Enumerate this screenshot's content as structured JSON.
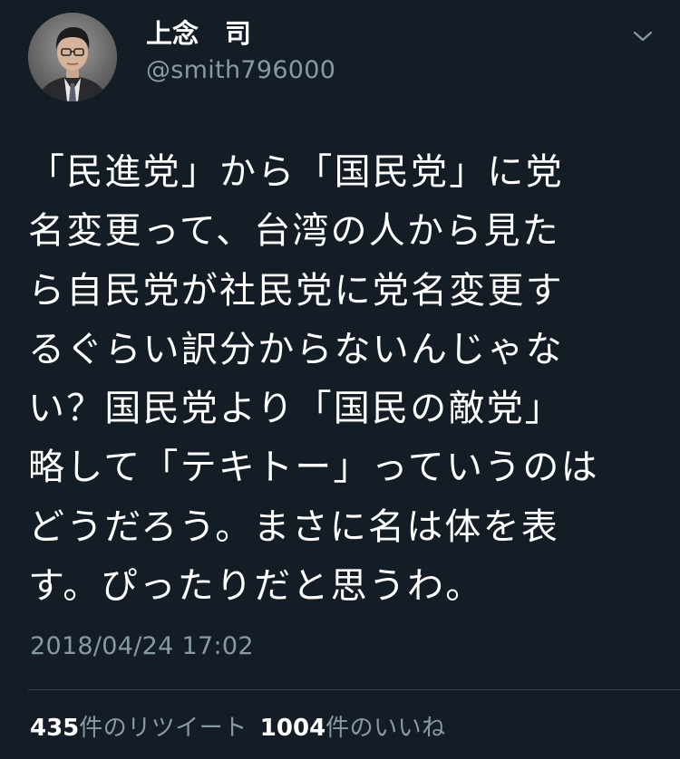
{
  "author": {
    "display_name": "上念　司",
    "handle": "@smith796000"
  },
  "tweet": {
    "lines": [
      "「民進党」から「国民党」に党",
      "名変更って、台湾の人から見た",
      "ら自民党が社民党に党名変更す",
      "るぐらい訳分からないんじゃな",
      "い？国民党より「国民の敵党」",
      "略して「テキトー」っていうのは",
      "どうだろう。まさに名は体を表",
      "す。ぴったりだと思うわ。"
    ],
    "timestamp": "2018/04/24 17:02"
  },
  "stats": {
    "retweets_count": "435",
    "retweets_label": "件のリツイート",
    "likes_count": "1004",
    "likes_label": "件のいいね"
  },
  "icons": {
    "menu": "chevron-down-icon",
    "avatar": "profile-photo"
  },
  "colors": {
    "background": "#141d26",
    "primary_text": "#ffffff",
    "secondary_text": "#8899a6",
    "divider": "#38444d"
  }
}
